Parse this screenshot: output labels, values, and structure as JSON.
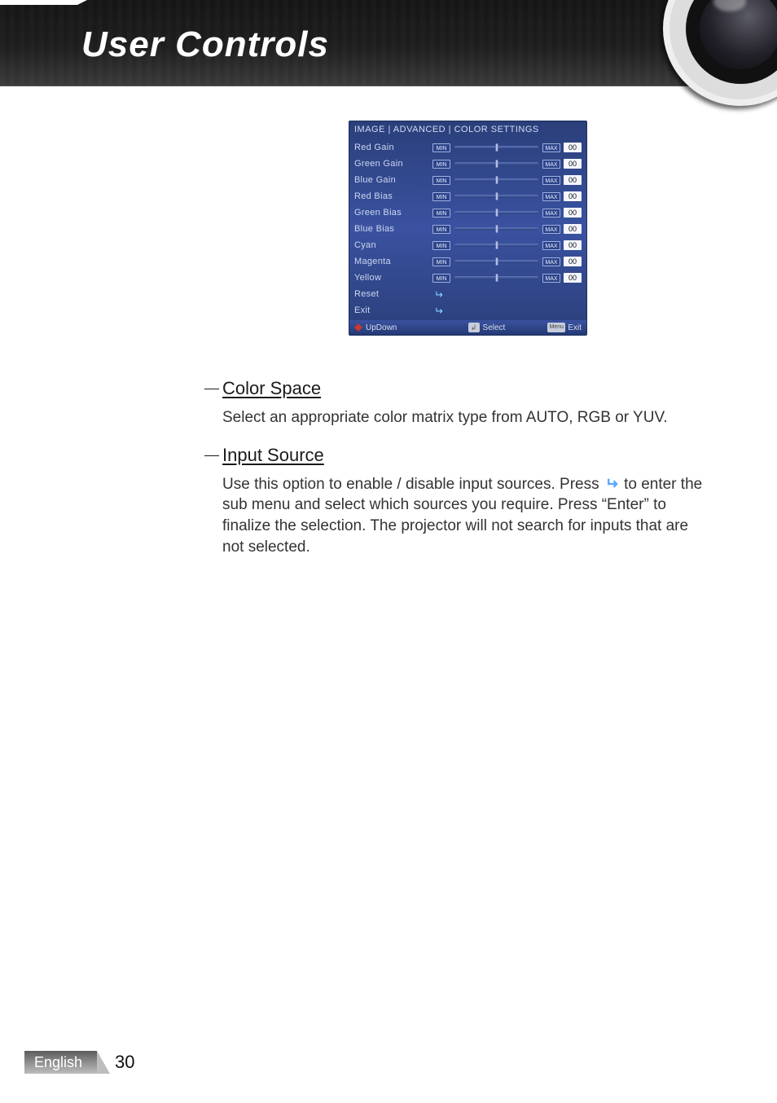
{
  "header": {
    "title": "User Controls"
  },
  "osd": {
    "title": "IMAGE | ADVANCED | COLOR SETTINGS",
    "min_label": "MIN",
    "max_label": "MAX",
    "rows": [
      {
        "label": "Red Gain",
        "value": "00"
      },
      {
        "label": "Green Gain",
        "value": "00"
      },
      {
        "label": "Blue Gain",
        "value": "00"
      },
      {
        "label": "Red Bias",
        "value": "00"
      },
      {
        "label": "Green Bias",
        "value": "00"
      },
      {
        "label": "Blue Bias",
        "value": "00"
      },
      {
        "label": "Cyan",
        "value": "00"
      },
      {
        "label": "Magenta",
        "value": "00"
      },
      {
        "label": "Yellow",
        "value": "00"
      }
    ],
    "reset_label": "Reset",
    "exit_label": "Exit",
    "footer": {
      "updown": "UpDown",
      "select": "Select",
      "menu_key": "Menu",
      "exit": "Exit"
    }
  },
  "sections": {
    "color_space": {
      "title": "Color Space",
      "body": "Select an appropriate color matrix type from AUTO, RGB or YUV."
    },
    "input_source": {
      "title": "Input Source",
      "body_pre": "Use this option to enable / disable input sources. Press ",
      "body_post": " to enter the sub menu and select which sources you require. Press “Enter” to finalize the selection. The projector will not search for inputs that are not selected."
    }
  },
  "footer": {
    "language": "English",
    "page": "30"
  }
}
